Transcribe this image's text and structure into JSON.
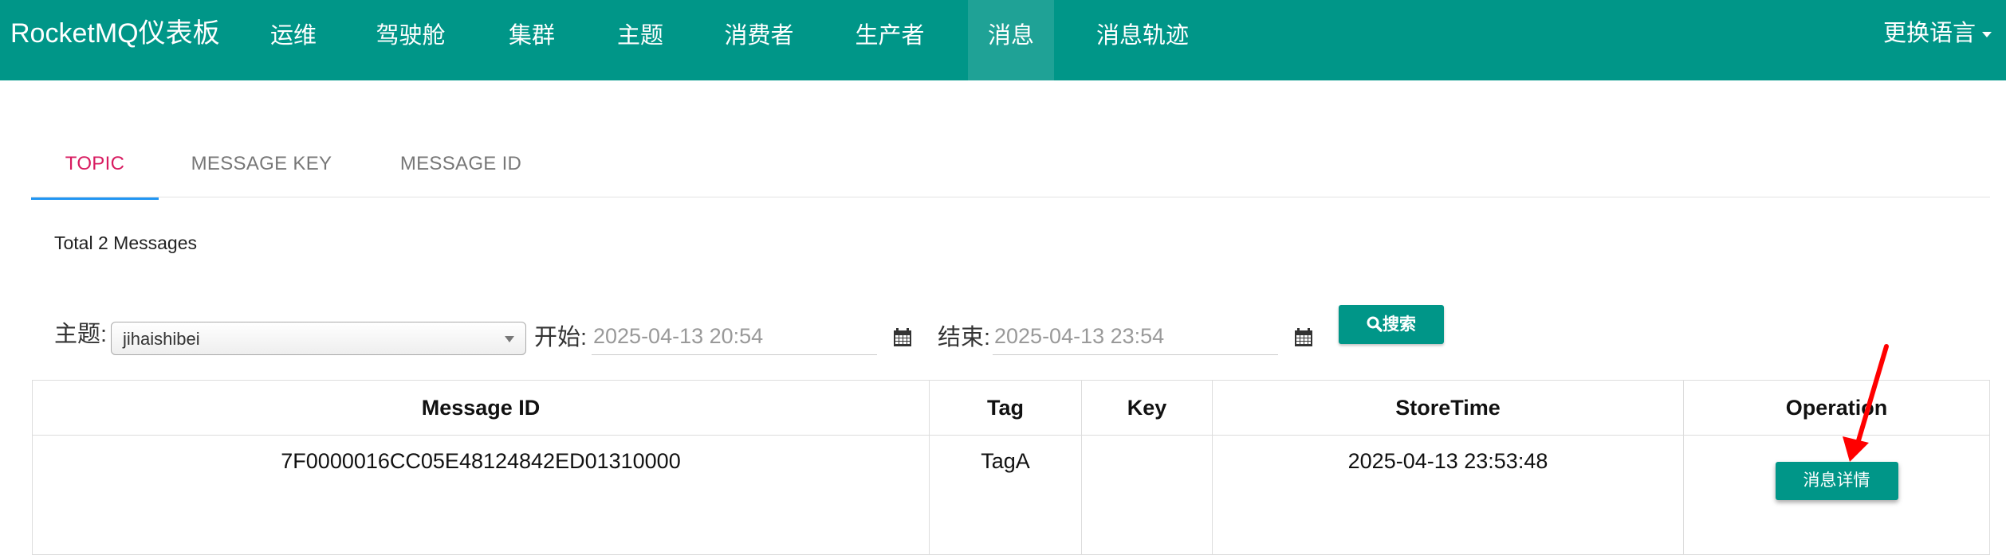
{
  "navbar": {
    "brand": "RocketMQ仪表板",
    "items": [
      "运维",
      "驾驶舱",
      "集群",
      "主题",
      "消费者",
      "生产者",
      "消息",
      "消息轨迹"
    ],
    "active_index": 6,
    "language": "更换语言"
  },
  "tabs": [
    {
      "label": "TOPIC",
      "active": true
    },
    {
      "label": "MESSAGE KEY",
      "active": false
    },
    {
      "label": "MESSAGE ID",
      "active": false
    }
  ],
  "summary": "Total 2 Messages",
  "filters": {
    "topic_label": "主题:",
    "topic_value": "jihaishibei",
    "start_label": "开始:",
    "start_value": "2025-04-13 20:54",
    "end_label": "结束:",
    "end_value": "2025-04-13 23:54",
    "search_label": "搜索"
  },
  "table": {
    "columns": [
      "Message ID",
      "Tag",
      "Key",
      "StoreTime",
      "Operation"
    ],
    "rows": [
      {
        "message_id": "7F0000016CC05E48124842ED01310000",
        "tag": "TagA",
        "key": "",
        "store_time": "2025-04-13 23:53:48",
        "operation": "消息详情"
      }
    ]
  },
  "colors": {
    "primary": "#009688",
    "tab_active_text": "#d81b60",
    "tab_indicator": "#2196f3",
    "annotation_arrow": "#ff0000"
  },
  "icons": [
    "search-icon",
    "calendar-icon",
    "chevron-down-icon",
    "annotation-arrow"
  ]
}
